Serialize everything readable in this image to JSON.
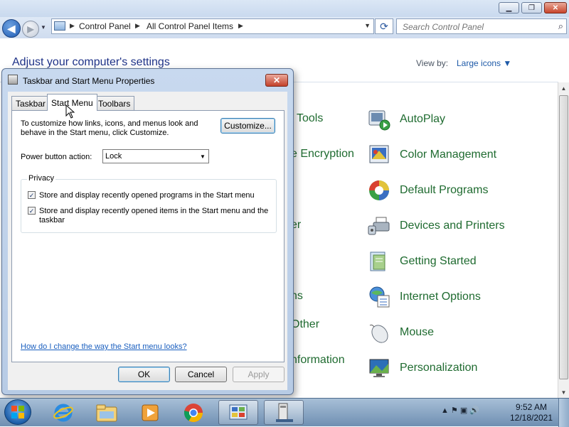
{
  "control_panel": {
    "caption": {
      "minimize": "▁",
      "maximize": "❐",
      "close": "✕"
    },
    "nav": {
      "back": "◀",
      "forward": "▶",
      "recent": "▼"
    },
    "address": {
      "crumbs": [
        "Control Panel",
        "All Control Panel Items"
      ],
      "sep": "▶",
      "drop": "▼"
    },
    "refresh": "⟳",
    "search_placeholder": "Search Control Panel",
    "search_icon": "⌕",
    "heading": "Adjust your computer's settings",
    "view_by_label": "View by:",
    "view_by_value": "Large icons ▼",
    "left_partial_items": [
      "Tools",
      "e Encryption",
      "er",
      "ns",
      "Other",
      "nformation"
    ],
    "items": [
      {
        "label": "AutoPlay",
        "icon": "autoplay-icon"
      },
      {
        "label": "Color Management",
        "icon": "color-management-icon"
      },
      {
        "label": "Default Programs",
        "icon": "default-programs-icon"
      },
      {
        "label": "Devices and Printers",
        "icon": "devices-printers-icon"
      },
      {
        "label": "Getting Started",
        "icon": "getting-started-icon"
      },
      {
        "label": "Internet Options",
        "icon": "internet-options-icon"
      },
      {
        "label": "Mouse",
        "icon": "mouse-icon"
      },
      {
        "label": "Personalization",
        "icon": "personalization-icon"
      }
    ],
    "scroll": {
      "up": "▲",
      "down": "▼"
    }
  },
  "dialog": {
    "title": "Taskbar and Start Menu Properties",
    "close": "✕",
    "tabs": [
      "Taskbar",
      "Start Menu",
      "Toolbars"
    ],
    "active_tab": "Start Menu",
    "description": "To customize how links, icons, and menus look and behave in the Start menu, click Customize.",
    "customize_button": "Customize...",
    "power_button_label": "Power button action:",
    "power_button_value": "Lock",
    "power_button_arrow": "▼",
    "privacy_label": "Privacy",
    "checkboxes": [
      {
        "label": "Store and display recently opened programs in the Start menu",
        "checked": true,
        "mark": "✓"
      },
      {
        "label": "Store and display recently opened items in the Start menu and the taskbar",
        "checked": true,
        "mark": "✓"
      }
    ],
    "help_link": "How do I change the way the Start menu looks?",
    "buttons": {
      "ok": "OK",
      "cancel": "Cancel",
      "apply": "Apply"
    }
  },
  "taskbar": {
    "pinned": [
      "internet-explorer-icon",
      "windows-explorer-icon",
      "media-player-icon",
      "chrome-icon",
      "control-panel-icon",
      "taskbar-properties-icon"
    ],
    "tray_icons": "▲  ⚑  ▣  🔊",
    "clock": {
      "time": "9:52 AM",
      "date": "12/18/2021"
    }
  },
  "colors": {
    "accent": "#1e3287",
    "link_green": "#1f6b30",
    "link_blue": "#1a5fbf"
  }
}
